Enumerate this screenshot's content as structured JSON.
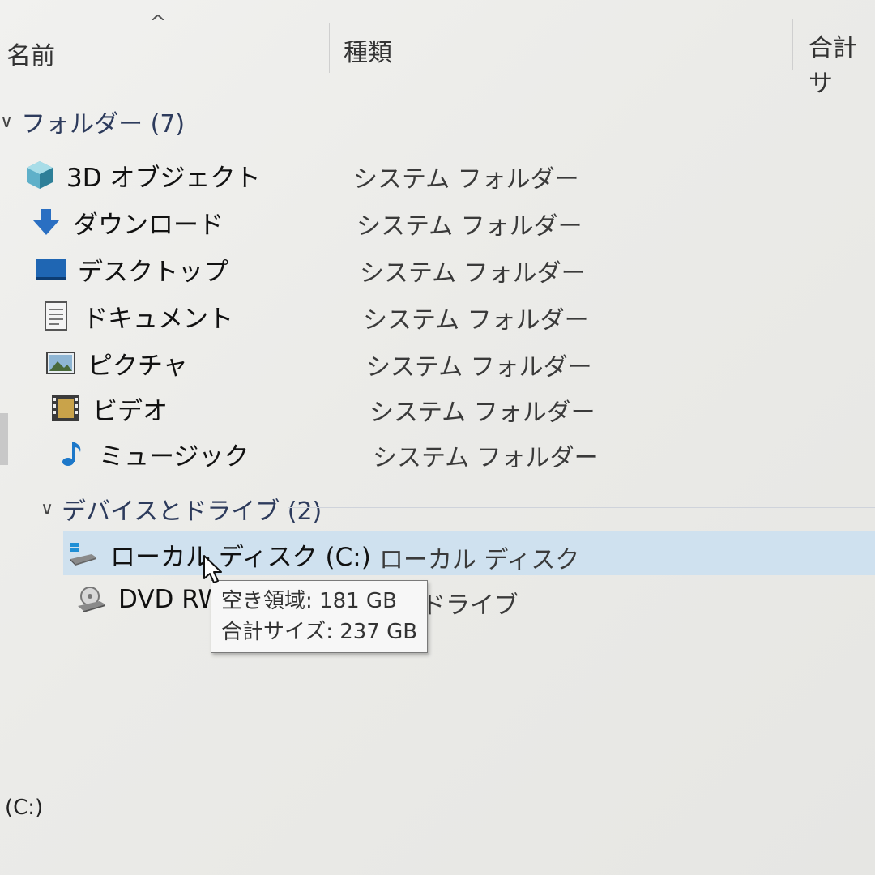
{
  "columns": {
    "name": "名前",
    "type": "種類",
    "total_size": "合計サ",
    "sort_indicator": "^"
  },
  "groups": {
    "folders": {
      "title": "フォルダー (7)",
      "items": [
        {
          "name": "3D オブジェクト",
          "type": "システム フォルダー",
          "icon": "3d-objects-icon"
        },
        {
          "name": "ダウンロード",
          "type": "システム フォルダー",
          "icon": "download-icon"
        },
        {
          "name": "デスクトップ",
          "type": "システム フォルダー",
          "icon": "desktop-icon"
        },
        {
          "name": "ドキュメント",
          "type": "システム フォルダー",
          "icon": "document-icon"
        },
        {
          "name": "ピクチャ",
          "type": "システム フォルダー",
          "icon": "picture-icon"
        },
        {
          "name": "ビデオ",
          "type": "システム フォルダー",
          "icon": "video-icon"
        },
        {
          "name": "ミュージック",
          "type": "システム フォルダー",
          "icon": "music-icon"
        }
      ]
    },
    "devices": {
      "title": "デバイスとドライブ (2)",
      "items": [
        {
          "name": "ローカル ディスク (C:)",
          "type": "ローカル ディスク",
          "icon": "local-disk-icon",
          "selected": true
        },
        {
          "name": "DVD RW",
          "type": "ドライブ",
          "icon": "dvd-drive-icon"
        }
      ]
    }
  },
  "tooltip": {
    "free_space": "空き領域: 181 GB",
    "total_size": "合計サイズ: 237 GB"
  },
  "status_bar": {
    "text": "(C:)"
  },
  "colors": {
    "selection": "#cfe1ef",
    "group_header": "#2d3b5c",
    "tooltip_bg": "#f7f7f7"
  }
}
